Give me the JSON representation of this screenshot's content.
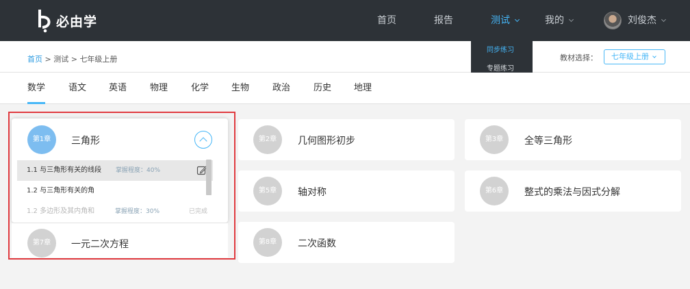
{
  "brand": {
    "logo_text": "必由学"
  },
  "nav": {
    "items": [
      {
        "label": "首页"
      },
      {
        "label": "报告"
      },
      {
        "label": "测试"
      },
      {
        "label": "我的"
      }
    ],
    "user_name": "刘俊杰"
  },
  "dropdown": {
    "items": [
      {
        "label": "同步练习"
      },
      {
        "label": "专题练习"
      }
    ]
  },
  "breadcrumb": {
    "home": "首页",
    "sep1": ">",
    "level2": "测试",
    "sep2": ">",
    "level3": "七年级上册"
  },
  "textbook": {
    "label": "教材选择：",
    "value": "七年级上册"
  },
  "subjects": [
    "数学",
    "语文",
    "英语",
    "物理",
    "化学",
    "生物",
    "政治",
    "历史",
    "地理"
  ],
  "active_subject": "数学",
  "chapters": [
    {
      "badge": "第1章",
      "title": "三角形",
      "expanded": true
    },
    {
      "badge": "第2章",
      "title": "几何图形初步"
    },
    {
      "badge": "第3章",
      "title": "全等三角形"
    },
    {
      "badge": "第5章",
      "title": "轴对称"
    },
    {
      "badge": "第6章",
      "title": "整式的乘法与因式分解"
    },
    {
      "badge": "第7章",
      "title": "一元二次方程"
    },
    {
      "badge": "第8章",
      "title": "二次函数"
    }
  ],
  "sections": [
    {
      "label": "1.1  与三角形有关的线段",
      "mastery": "掌握程度：40%",
      "status": ""
    },
    {
      "label": "1.2  与三角形有关的角",
      "mastery": "",
      "status": ""
    },
    {
      "label": "1.2  多边形及其内角和",
      "mastery": "掌握程度：30%",
      "status": "已完成"
    }
  ],
  "colors": {
    "accent": "#45b6f7",
    "nav_bg": "#2d3237",
    "highlight_box": "#e0393e"
  }
}
